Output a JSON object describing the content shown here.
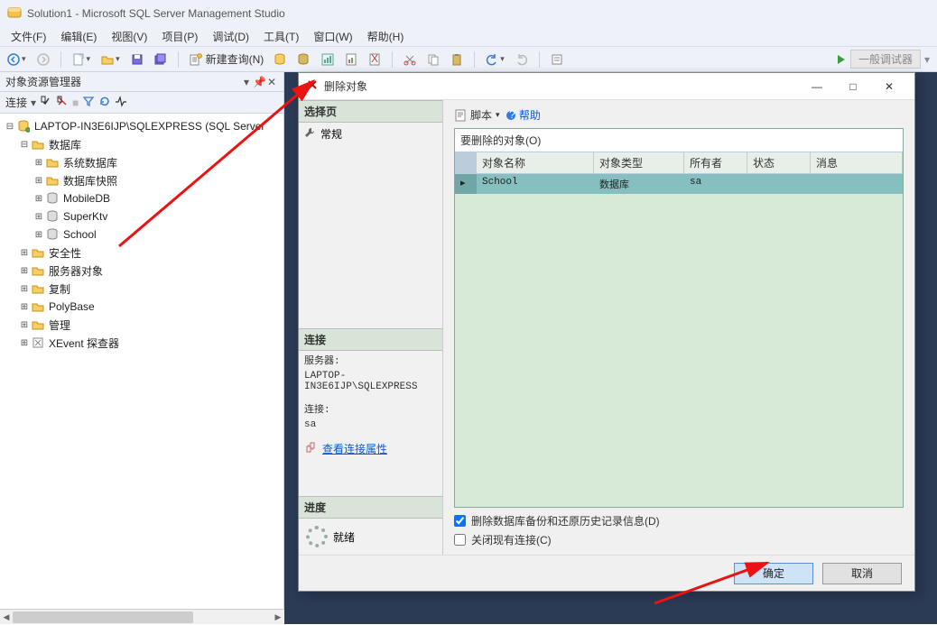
{
  "app": {
    "title": "Solution1 - Microsoft SQL Server Management Studio"
  },
  "menu": {
    "file": "文件(F)",
    "edit": "编辑(E)",
    "view": "视图(V)",
    "project": "项目(P)",
    "debug": "调试(D)",
    "tools": "工具(T)",
    "window": "窗口(W)",
    "help": "帮助(H)"
  },
  "toolbar": {
    "new_query": "新建查询(N)",
    "debug_dropdown": "一般调试器"
  },
  "objectExplorer": {
    "title": "对象资源管理器",
    "connect_label": "连接",
    "server": "LAPTOP-IN3E6IJP\\SQLEXPRESS (SQL Server",
    "nodes": {
      "databases": "数据库",
      "sysdb": "系统数据库",
      "dbSnap": "数据库快照",
      "mobile": "MobileDB",
      "superktv": "SuperKtv",
      "school": "School",
      "security": "安全性",
      "serverObj": "服务器对象",
      "replication": "复制",
      "polybase": "PolyBase",
      "management": "管理",
      "xevent": "XEvent 探查器"
    }
  },
  "dialog": {
    "title": "删除对象",
    "selectPage": "选择页",
    "general": "常规",
    "connection": "连接",
    "serverLabel": "服务器:",
    "serverValue": "LAPTOP-IN3E6IJP\\SQLEXPRESS",
    "connLabel": "连接:",
    "connValue": "sa",
    "viewConnProps": "查看连接属性",
    "progress": "进度",
    "ready": "就绪",
    "scriptLabel": "脚本",
    "helpLabel": "帮助",
    "panelTitle": "要删除的对象(O)",
    "columns": {
      "name": "对象名称",
      "type": "对象类型",
      "owner": "所有者",
      "status": "状态",
      "message": "消息"
    },
    "row": {
      "name": "School",
      "type": "数据库",
      "owner": "sa",
      "status": "",
      "message": ""
    },
    "chk1": "删除数据库备份和还原历史记录信息(D)",
    "chk2": "关闭现有连接(C)",
    "ok": "确定",
    "cancel": "取消"
  }
}
